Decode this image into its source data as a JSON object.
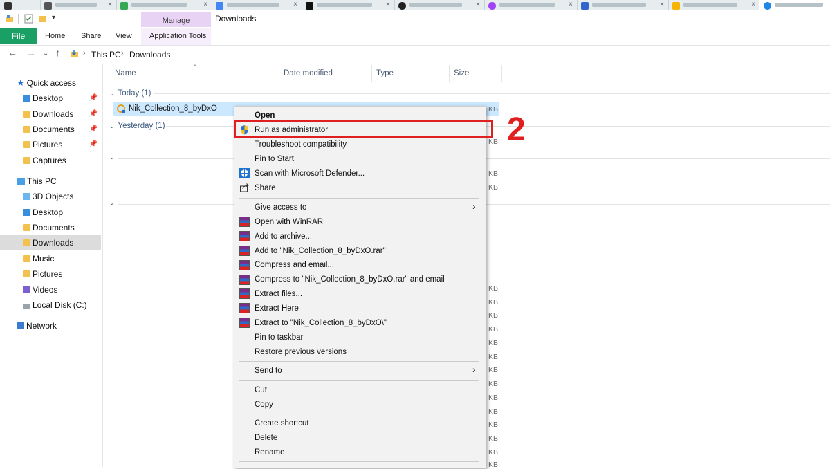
{
  "window": {
    "title": "Downloads"
  },
  "ribbon": {
    "contextual_group": "Manage",
    "tabs": [
      "File",
      "Home",
      "Share",
      "View",
      "Application Tools"
    ]
  },
  "address_bar": {
    "crumbs": [
      "This PC",
      "Downloads"
    ]
  },
  "nav_pane": {
    "quick_access": "Quick access",
    "quick_items": [
      "Desktop",
      "Downloads",
      "Documents",
      "Pictures",
      "Captures"
    ],
    "this_pc": "This PC",
    "pc_items": [
      "3D Objects",
      "Desktop",
      "Documents",
      "Downloads",
      "Music",
      "Pictures",
      "Videos",
      "Local Disk (C:)"
    ],
    "network": "Network",
    "selected": "Downloads"
  },
  "columns": [
    "Name",
    "Date modified",
    "Type",
    "Size"
  ],
  "groups": {
    "today": "Today (1)",
    "yesterday": "Yesterday (1)"
  },
  "selected_file": "Nik_Collection_8_byDxO",
  "size_unit": "KB",
  "context_menu": {
    "items": [
      "Open",
      "Run as administrator",
      "Troubleshoot compatibility",
      "Pin to Start",
      "Scan with Microsoft Defender...",
      "Share",
      "Give access to",
      "Open with WinRAR",
      "Add to archive...",
      "Add to \"Nik_Collection_8_byDxO.rar\"",
      "Compress and email...",
      "Compress to \"Nik_Collection_8_byDxO.rar\" and email",
      "Extract files...",
      "Extract Here",
      "Extract to \"Nik_Collection_8_byDxO\\\"",
      "Pin to taskbar",
      "Restore previous versions",
      "Send to",
      "Cut",
      "Copy",
      "Create shortcut",
      "Delete",
      "Rename"
    ]
  },
  "annotation": {
    "step": "2",
    "color": "#e02020"
  }
}
